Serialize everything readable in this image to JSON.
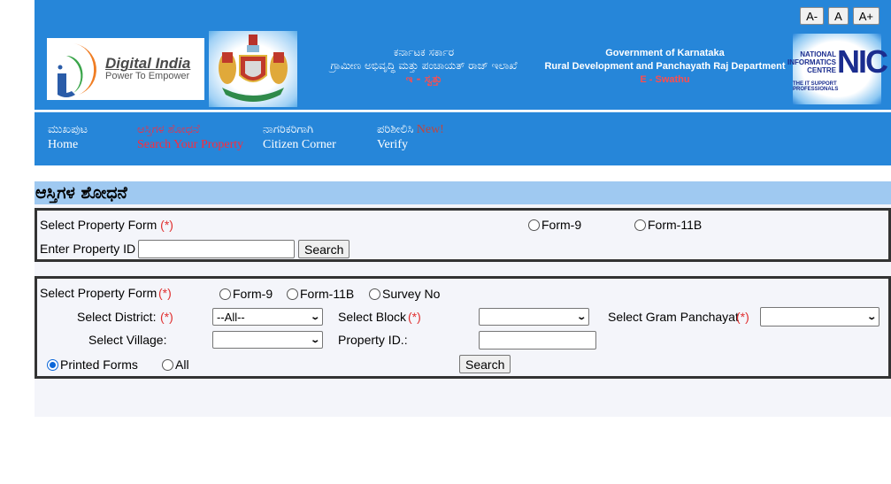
{
  "font_controls": {
    "decrease": "A-",
    "normal": "A",
    "increase": "A+"
  },
  "header": {
    "digital_india": {
      "title": "Digital India",
      "subtitle": "Power To Empower"
    },
    "kannada": {
      "line1": "ಕರ್ನಾಟಕ ಸರ್ಕಾರ",
      "line2": "ಗ್ರಾಮೀಣ ಅಭಿವೃದ್ಧಿ ಮತ್ತು ಪಂಚಾಯತ್ ರಾಜ್ ಇಲಾಖೆ",
      "line3": "ಇ - ಸ್ವತ್ತು"
    },
    "english": {
      "line1": "Government of Karnataka",
      "line2": "Rural Development and Panchayath Raj Department",
      "line3": "E - Swathu"
    },
    "nic": {
      "line1": "NATIONAL",
      "line2": "INFORMATICS",
      "line3": "CENTRE",
      "big": "NIC",
      "tagline": "THE IT SUPPORT PROFESSIONALS"
    }
  },
  "nav": {
    "items": [
      {
        "kn": "ಮುಖಪುಟ",
        "en": "Home",
        "active": false
      },
      {
        "kn": "ಆಸ್ತಿಗಳ ಶೋಧನೆ",
        "en": "Search Your Property",
        "active": true
      },
      {
        "kn": "ನಾಗರಿಕರಿಗಾಗಿ",
        "en": "Citizen Corner",
        "active": false
      },
      {
        "kn": "ಪರಿಶೀಲಿಸಿ",
        "en": "Verify",
        "badge": "New!",
        "active": false
      }
    ]
  },
  "section_title": "ಆಸ್ತಿಗಳ ಶೋಧನೆ",
  "form1": {
    "select_form_label": "Select Property Form",
    "required": "(*)",
    "radio_form9": "Form-9",
    "radio_form11b": "Form-11B",
    "property_id_label": "Enter Property ID :",
    "property_id_value": "",
    "search_label": "Search"
  },
  "form2": {
    "select_form_label": "Select Property Form",
    "required": "(*)",
    "radio_form9": "Form-9",
    "radio_form11b": "Form-11B",
    "radio_survey": "Survey No",
    "district_label": "Select District:",
    "district_value": "--All--",
    "block_label": "Select Block",
    "block_value": "",
    "gp_label": "Select Gram Panchayat",
    "gp_value": "",
    "village_label": "Select Village:",
    "village_value": "",
    "property_id_label": "Property ID.:",
    "property_id_value": "",
    "printed_forms_label": "Printed Forms",
    "printed_forms_checked": true,
    "all_label": "All",
    "search_label": "Search"
  },
  "colors": {
    "header_blue": "#2686d9",
    "section_title_bg": "#9fc9f1",
    "active_nav": "#ff2a3a",
    "required": "#e03030",
    "panel_bg": "#f4f5fa"
  }
}
